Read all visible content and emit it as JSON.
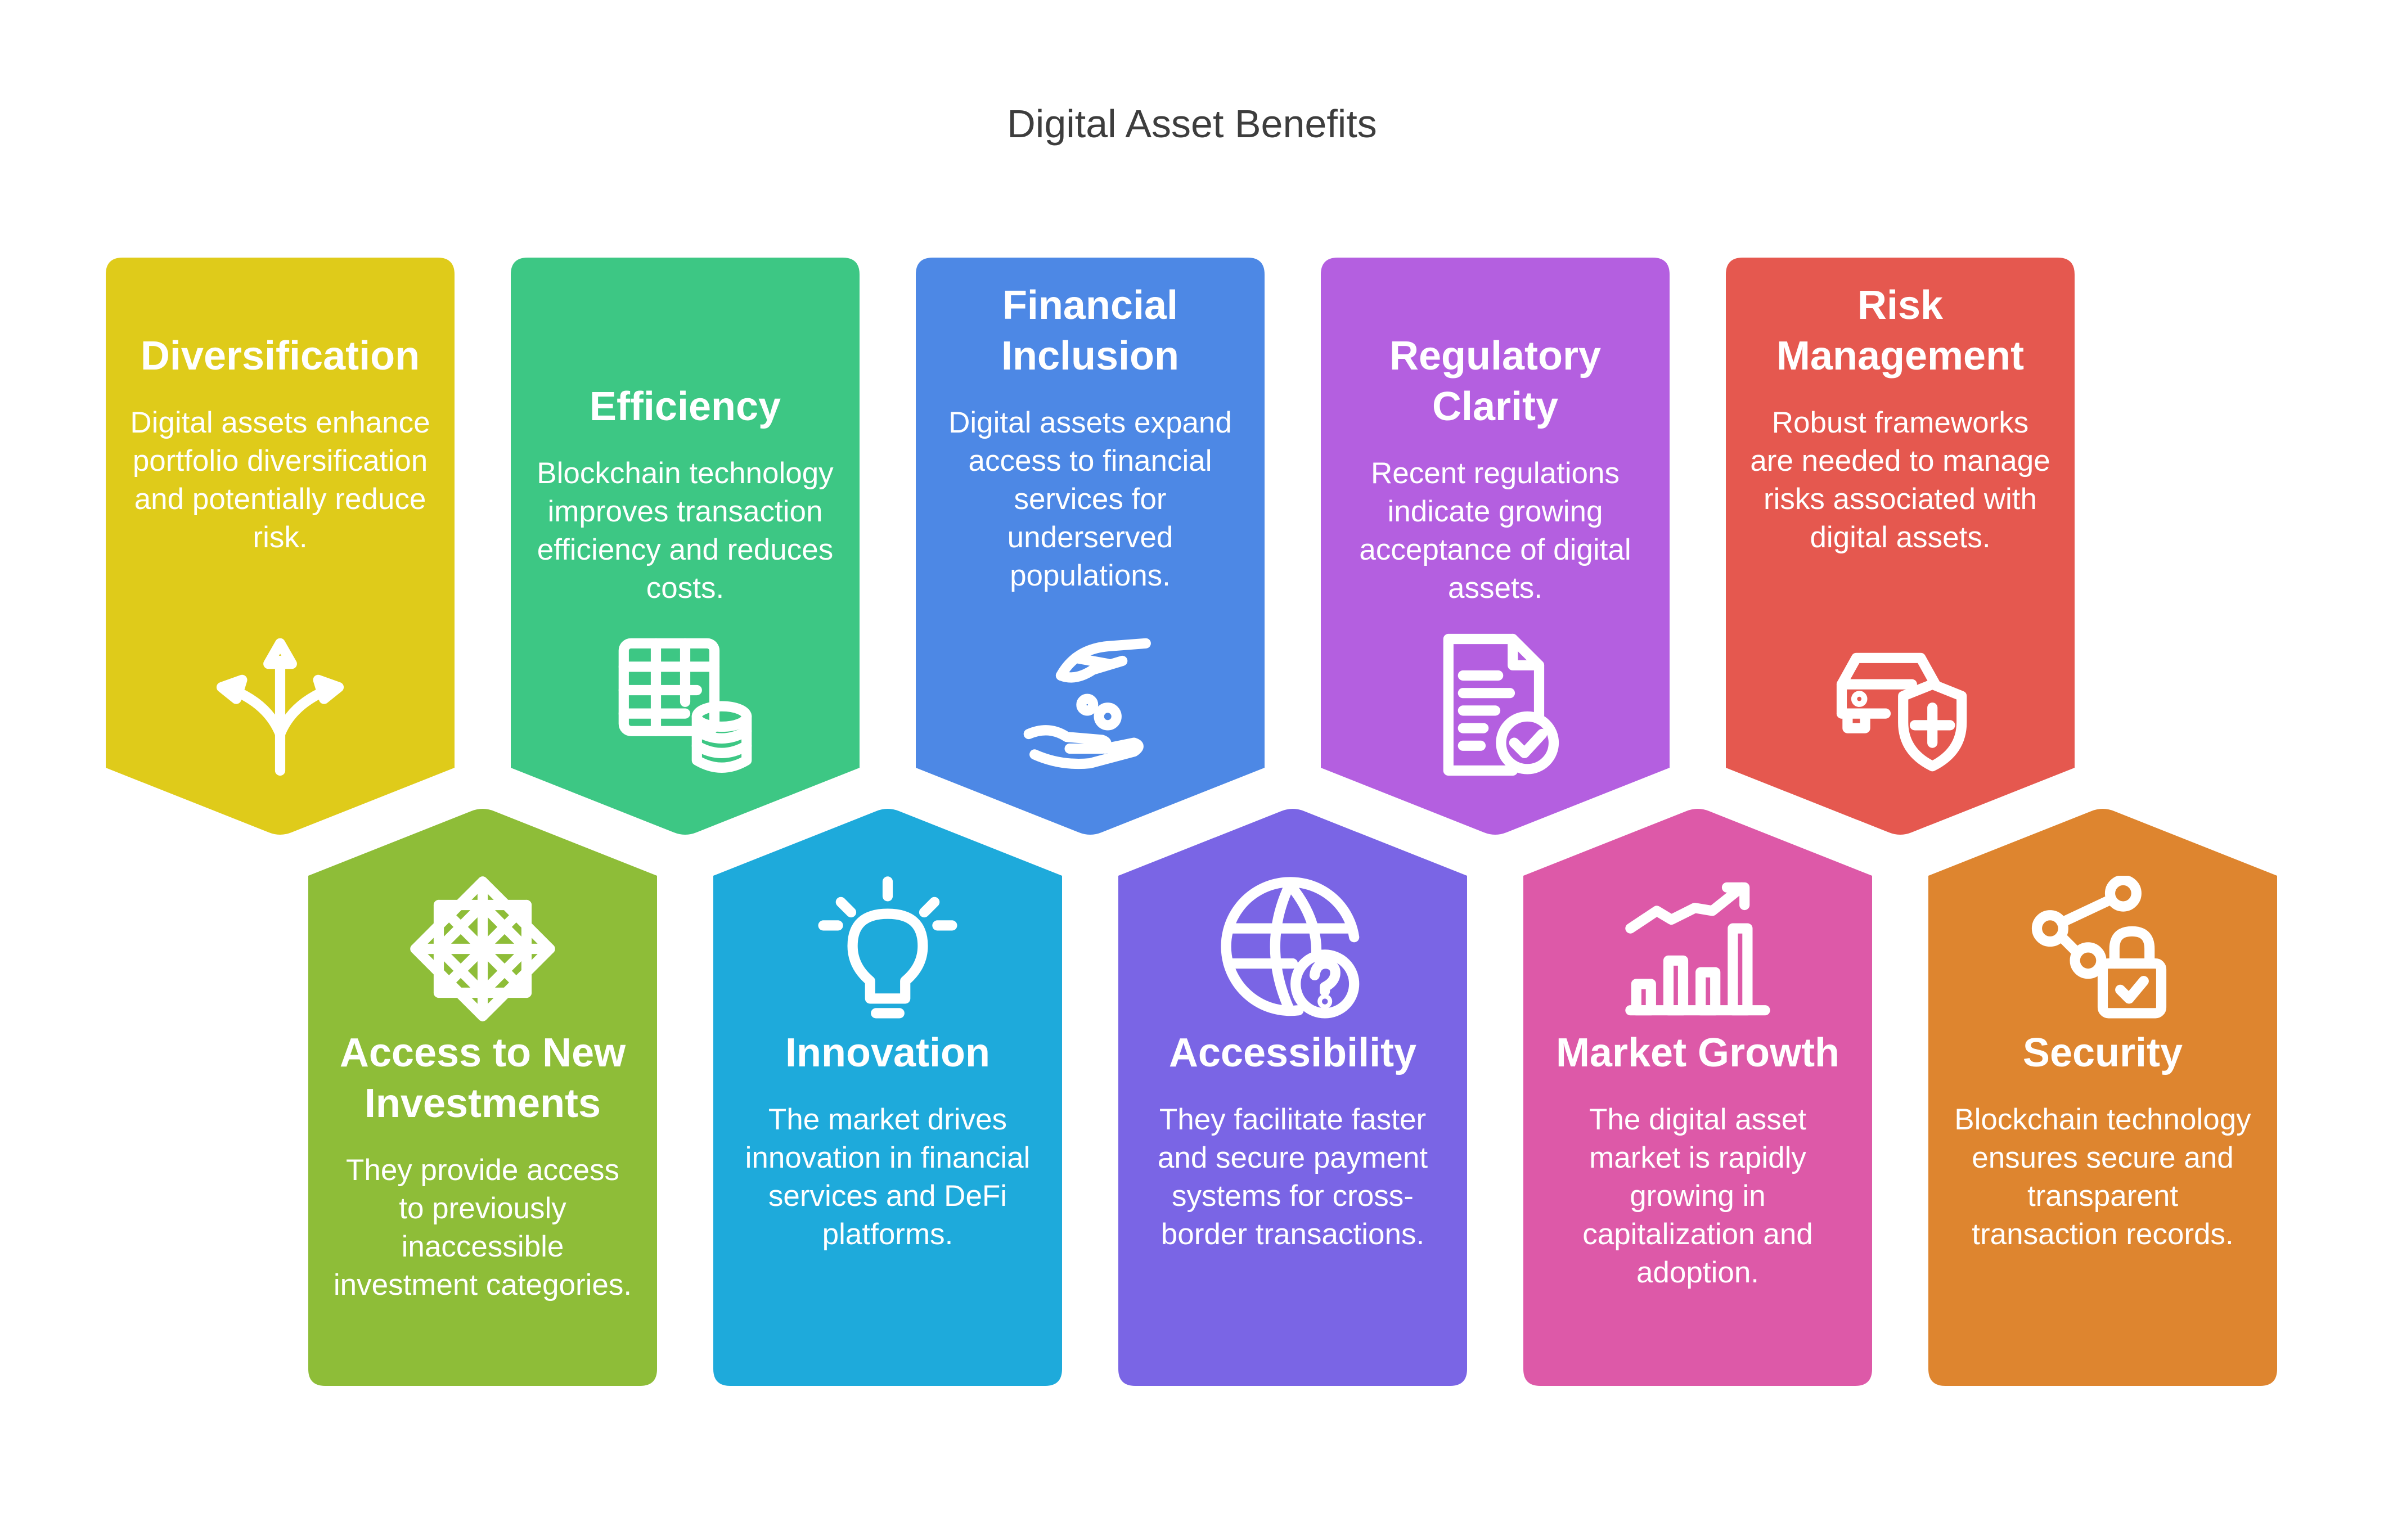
{
  "title": "Digital Asset Benefits",
  "top_cards": [
    {
      "heading": "Diversification",
      "text": "Digital assets enhance portfolio diversification and potentially reduce risk.",
      "color": "#DFCB1A",
      "icon": "diverging-arrows-icon"
    },
    {
      "heading": "Efficiency",
      "text": "Blockchain technology improves transaction efficiency and reduces costs.",
      "color": "#3DC784",
      "icon": "table-database-icon"
    },
    {
      "heading": "Financial Inclusion",
      "text": "Digital assets expand access to financial services for underserved populations.",
      "color": "#4D88E5",
      "icon": "hand-coins-icon"
    },
    {
      "heading": "Regulatory Clarity",
      "text": "Recent regulations indicate growing acceptance of digital assets.",
      "color": "#B45FE0",
      "icon": "document-check-icon"
    },
    {
      "heading": "Risk Management",
      "text": "Robust frameworks are needed to manage risks associated with digital assets.",
      "color": "#E5584F",
      "icon": "car-shield-icon"
    }
  ],
  "bottom_cards": [
    {
      "heading": "Access to New Investments",
      "text": "They provide access to previously inaccessible investment categories.",
      "color": "#8EBD38",
      "icon": "network-pattern-icon"
    },
    {
      "heading": "Innovation",
      "text": "The market drives innovation in financial services and DeFi platforms.",
      "color": "#1EAADB",
      "icon": "lightbulb-icon"
    },
    {
      "heading": "Accessibility",
      "text": "They facilitate faster and secure payment systems for cross-border transactions.",
      "color": "#7A65E5",
      "icon": "globe-question-icon"
    },
    {
      "heading": "Market Growth",
      "text": "The digital asset market is rapidly growing in capitalization and adoption.",
      "color": "#DD59A8",
      "icon": "bar-chart-growth-icon"
    },
    {
      "heading": "Security",
      "text": "Blockchain technology ensures secure and transparent transaction records.",
      "color": "#DE852F",
      "icon": "share-lock-icon"
    }
  ]
}
